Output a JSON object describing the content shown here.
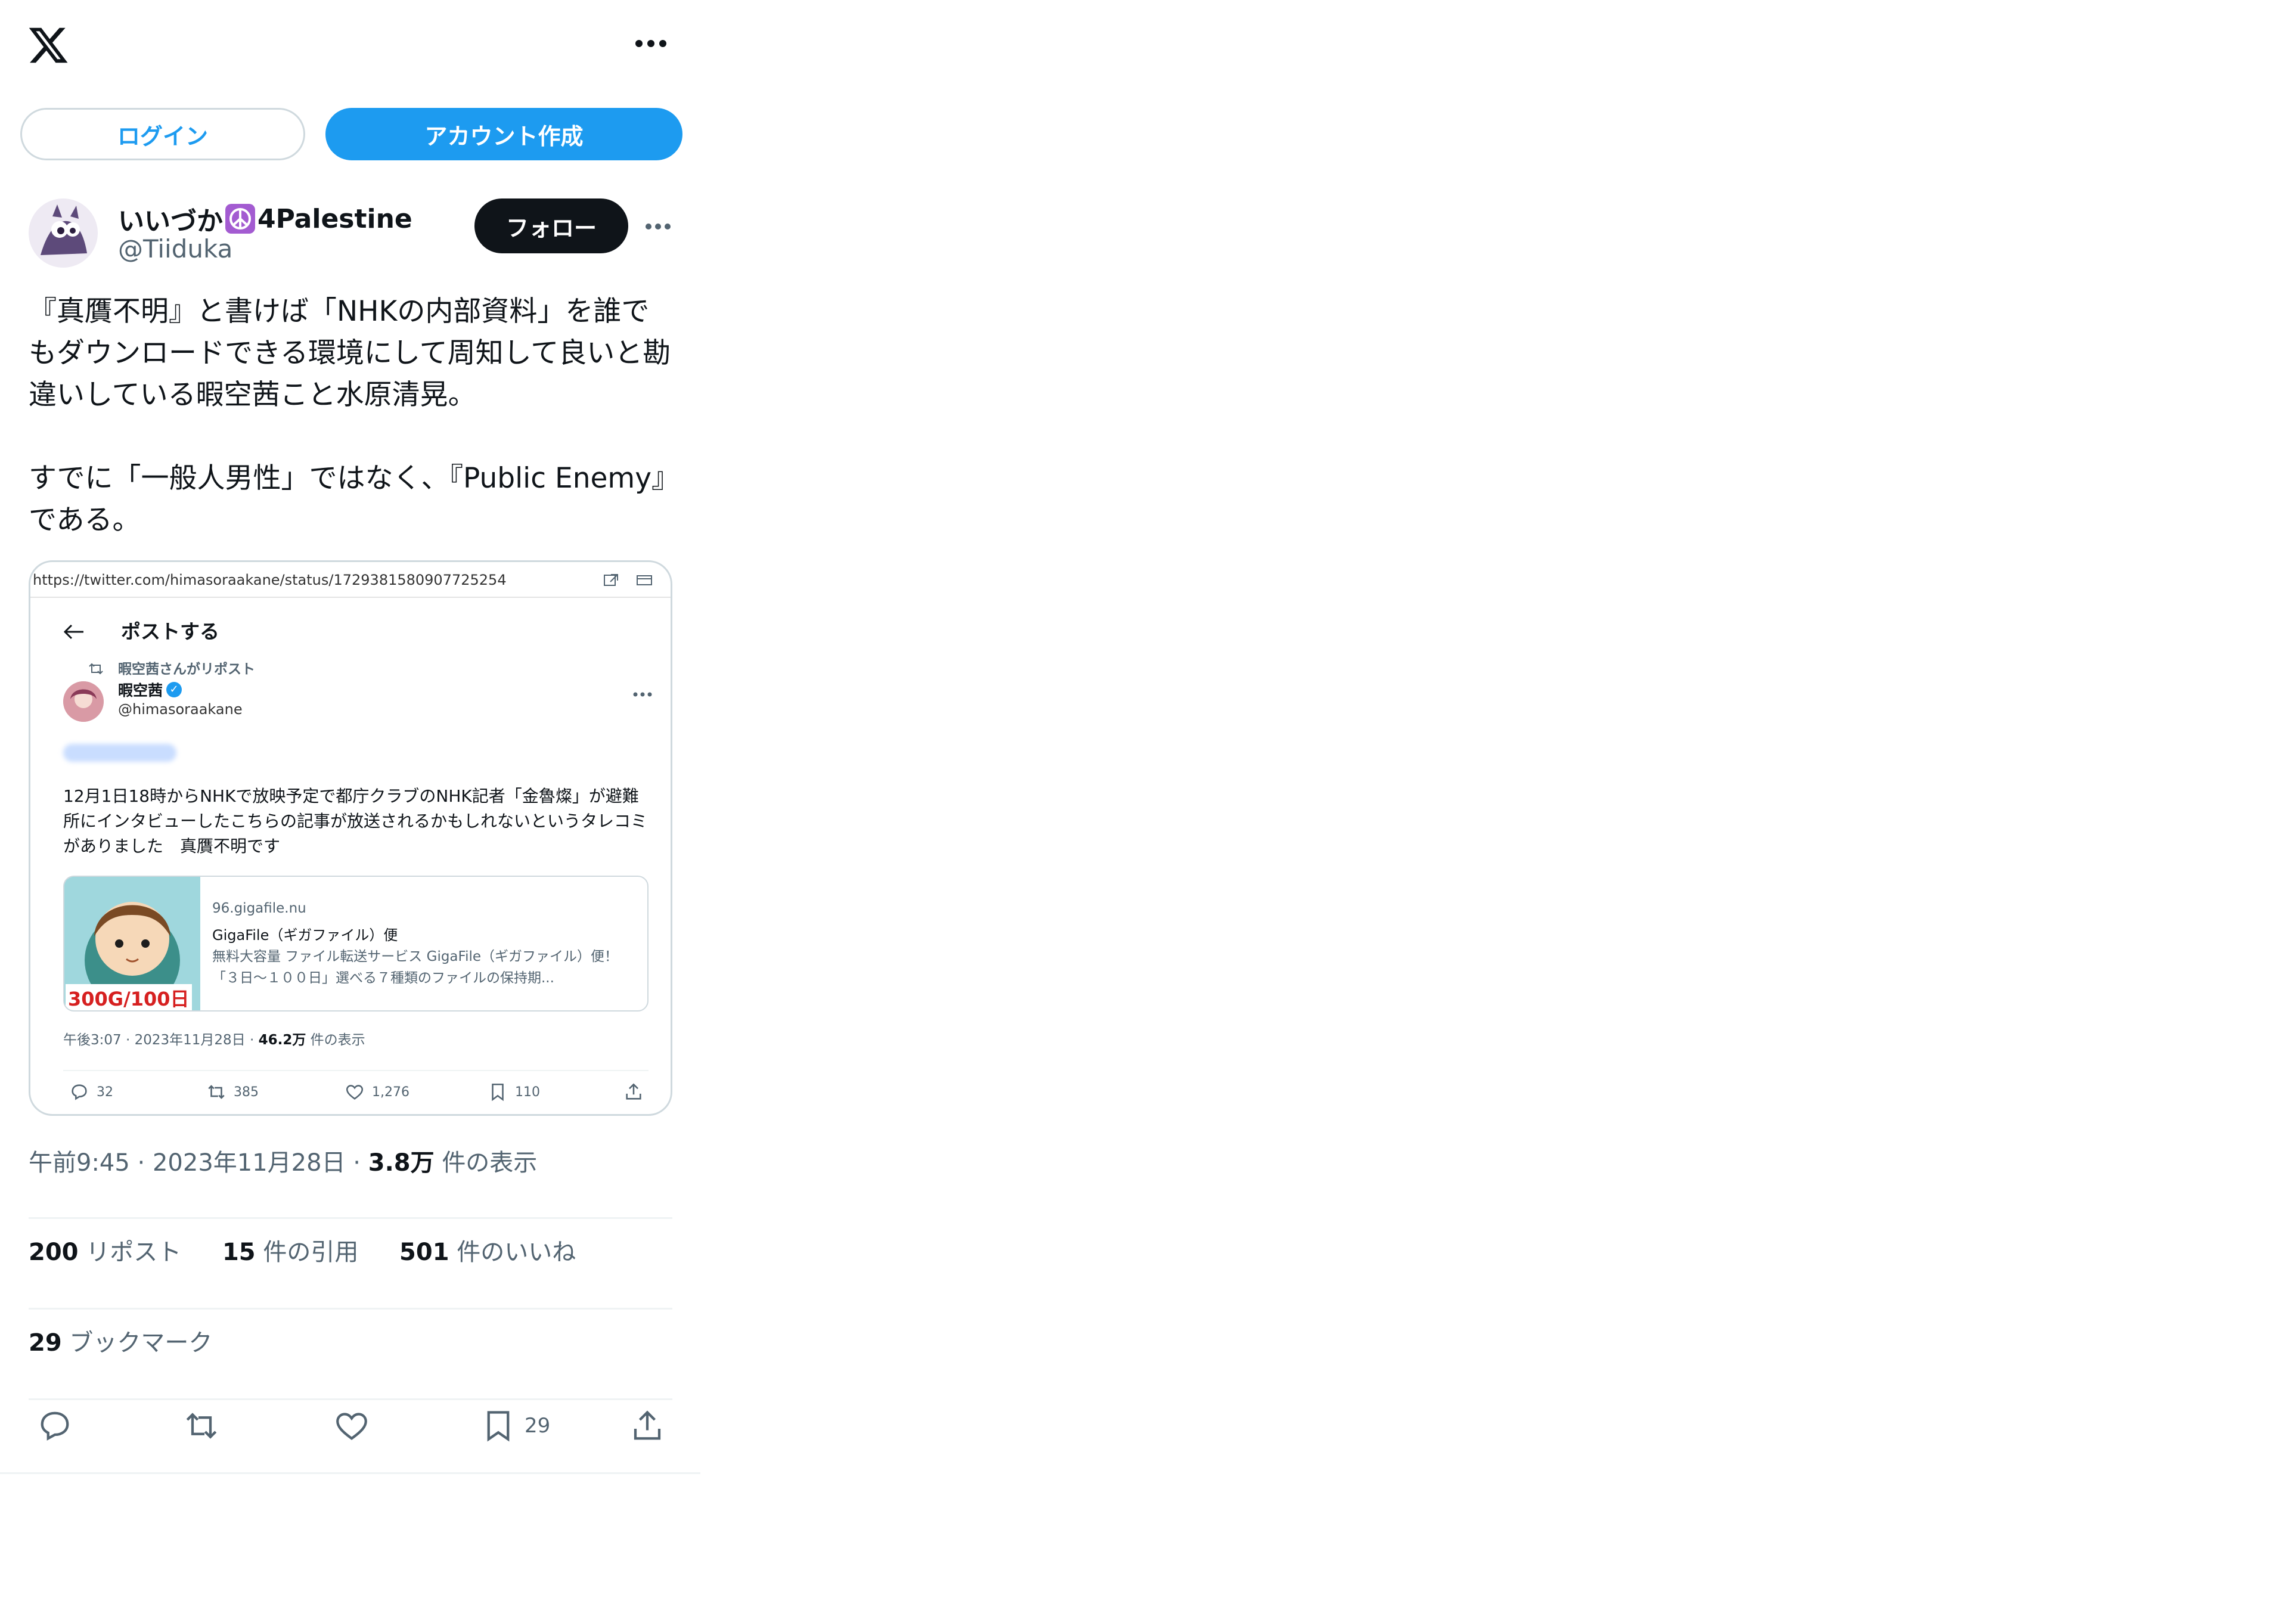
{
  "header": {
    "logo": "x-logo-icon",
    "more": "more-icon"
  },
  "auth": {
    "login_label": "ログイン",
    "signup_label": "アカウント作成"
  },
  "tweet": {
    "author_name": "いいづか",
    "author_emoji": "peace-icon",
    "author_name_suffix": "4Palestine",
    "handle": "@Tiiduka",
    "follow_label": "フォロー",
    "text_p1": "『真贋不明』と書けば「NHKの内部資料」を誰でもダウンロードできる環境にして周知して良いと勘違いしている暇空茜こと水原清晃。",
    "text_p2": "すでに「一般人男性」ではなく、『Public Enemy』である。",
    "time": "午前9:45",
    "date": "2023年11月28日",
    "views_count": "3.8万",
    "views_label": "件の表示",
    "reposts_count": "200",
    "reposts_label": "リポスト",
    "quotes_count": "15",
    "quotes_label": "件の引用",
    "likes_count": "501",
    "likes_label": "件のいいね",
    "bookmarks_count": "29",
    "bookmarks_label": "ブックマーク",
    "action_bookmark_count": "29"
  },
  "media": {
    "url": "https://twitter.com/himasoraakane/status/1729381580907725254",
    "title": "ポストする",
    "repost_note": "暇空茜さんがリポスト",
    "author_name": "暇空茜",
    "handle": "@himasoraakane",
    "text": "12月1日18時からNHKで放映予定で都庁クラブのNHK記者「金魯燦」が避難所にインタビューしたこちらの記事が放送されるかもしれないというタレコミがありました　真贋不明です",
    "card": {
      "thumb_label": "300G/100日",
      "domain": "96.gigafile.nu",
      "title": "GigaFile（ギガファイル）便",
      "desc": "無料大容量 ファイル転送サービス GigaFile（ギガファイル）便！「３日〜１００日」選べる７種類のファイルの保持期..."
    },
    "meta_time": "午後3:07 · 2023年11月28日 · ",
    "meta_views": "46.2万",
    "meta_views_label": " 件の表示",
    "stats": {
      "replies": "32",
      "reposts": "385",
      "likes": "1,276",
      "bookmarks": "110"
    }
  },
  "colors": {
    "accent": "#1d9bf0",
    "text": "#0f1419",
    "muted": "#536471",
    "border": "#cfd9de"
  }
}
